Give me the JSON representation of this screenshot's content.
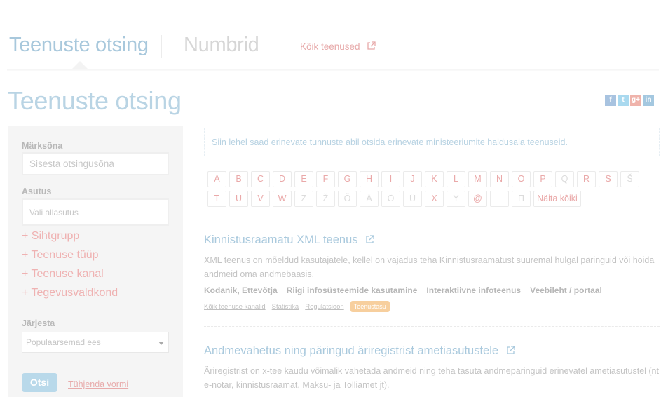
{
  "topnav": {
    "tab_main": "Teenuste otsing",
    "tab_secondary": "Numbrid",
    "all_services_link": "Kõik teenused"
  },
  "page": {
    "title": "Teenuste otsing"
  },
  "social": [
    {
      "icon": "facebook-icon",
      "glyph": "f",
      "color": "#a8c3e0"
    },
    {
      "icon": "twitter-icon",
      "glyph": "t",
      "color": "#a9d9ef"
    },
    {
      "icon": "googleplus-icon",
      "glyph": "g+",
      "color": "#efb3ab"
    },
    {
      "icon": "linkedin-icon",
      "glyph": "in",
      "color": "#a4c8e0"
    }
  ],
  "sidebar": {
    "keyword_label": "Märksõna",
    "keyword_placeholder": "Sisesta otsingusõna",
    "agency_label": "Asutus",
    "agency_placeholder": "Vali allasutus",
    "filters": [
      "+ Sihtgrupp",
      "+ Teenuse tüüp",
      "+ Teenuse kanal",
      "+ Tegevusvaldkond"
    ],
    "sort_label": "Järjesta",
    "sort_value": "Populaarsemad ees",
    "submit_label": "Otsi",
    "reset_label": "Tühjenda vormi"
  },
  "intro_text": "Siin lehel saad erinevate tunnuste abil otsida erinevate ministeeriumite haldusala teenuseid.",
  "letters": {
    "row1": [
      "A",
      "B",
      "C",
      "D",
      "E",
      "F",
      "G",
      "H",
      "I",
      "J",
      "K",
      "L",
      "M",
      "N",
      "O",
      "P",
      "Q",
      "R",
      "S",
      "Š"
    ],
    "row2": [
      "T",
      "U",
      "V",
      "W",
      "Z",
      "Ž",
      "Õ",
      "Ä",
      "Ö",
      "Ü",
      "X",
      "Y",
      "@",
      " ",
      "П",
      "Näita kõiki"
    ],
    "dim": [
      "Q",
      "Š",
      "Z",
      "Ž",
      "Õ",
      "Ä",
      "Ö",
      "Ü",
      "Y",
      "П"
    ]
  },
  "services": [
    {
      "title": "Kinnistusraamatu XML teenus",
      "description": "XML teenus on mõeldud kasutajatele, kellel on vajadus teha Kinnistusraamatust suuremal hulgal päringuid või hoida andmeid oma andmebaasis.",
      "tags": [
        "Kodanik, Ettevõtja",
        "Riigi infosüsteemide kasutamine",
        "Interaktiivne infoteenus",
        "Veebileht / portaal"
      ],
      "links": [
        "Kõik teenuse kanalid",
        "Statistika",
        "Regulatsioon"
      ],
      "badge": "Teenustasu"
    },
    {
      "title": "Andmevahetus ning päringud äriregistrist ametiasutustele",
      "description": "Äriregistrist on x-tee kaudu võimalik vahetada andmeid ning teha tasuta andmepäringuid erinevatel ametiasutustel (nt e-notar, kinnistusraamat, Maksu- ja Tolliamet jt)."
    }
  ]
}
